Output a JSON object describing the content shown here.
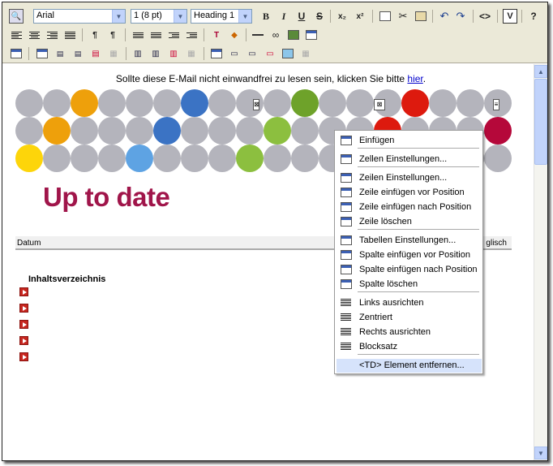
{
  "toolbar": {
    "font_name": "Arial",
    "font_size": "1 (8 pt)",
    "paragraph_style": "Heading 1",
    "bold_label": "B",
    "italic_label": "I",
    "underline_label": "U",
    "strike_label": "S",
    "subscript_label": "x₂",
    "superscript_label": "x²",
    "source_label": "<>",
    "validate_label": "V",
    "help_label": "?"
  },
  "document": {
    "notice_text": "Sollte diese E-Mail nicht einwandfrei zu lesen sein, klicken Sie bitte ",
    "notice_link": "hier",
    "notice_end": ".",
    "headline": "Up to date",
    "date_label": "Datum",
    "lang_label": "glisch",
    "toc_label": "Inhaltsverzeichnis",
    "circle_colors": {
      "grey": "#b4b4bc",
      "orange": "#eea00b",
      "blue_dark": "#3b73c4",
      "green": "#6ea22a",
      "red": "#dd1a0e",
      "crimson": "#b5083a",
      "yellow": "#fdd50a",
      "blue_light": "#5ea3e3",
      "green_light": "#8cbf3f"
    }
  },
  "context_menu": {
    "items": [
      {
        "label": "Einfügen",
        "icon": "paste-icon"
      },
      {
        "label": "Zellen Einstellungen...",
        "icon": "cell-properties-icon"
      },
      {
        "label": "Zeilen Einstellungen...",
        "icon": "row-properties-icon"
      },
      {
        "label": "Zeile einfügen vor Position",
        "icon": "insert-row-before-icon"
      },
      {
        "label": "Zeile einfügen nach Position",
        "icon": "insert-row-after-icon"
      },
      {
        "label": "Zeile löschen",
        "icon": "delete-row-icon"
      },
      {
        "label": "Tabellen Einstellungen...",
        "icon": "table-properties-icon"
      },
      {
        "label": "Spalte einfügen vor Position",
        "icon": "insert-column-before-icon"
      },
      {
        "label": "Spalte einfügen nach Position",
        "icon": "insert-column-after-icon"
      },
      {
        "label": "Spalte löschen",
        "icon": "delete-column-icon"
      },
      {
        "label": "Links ausrichten",
        "icon": "align-left-icon"
      },
      {
        "label": "Zentriert",
        "icon": "align-center-icon"
      },
      {
        "label": "Rechts ausrichten",
        "icon": "align-right-icon"
      },
      {
        "label": "Blocksatz",
        "icon": "justify-icon"
      },
      {
        "label": "<TD> Element entfernen...",
        "icon": "remove-element-icon"
      }
    ]
  }
}
